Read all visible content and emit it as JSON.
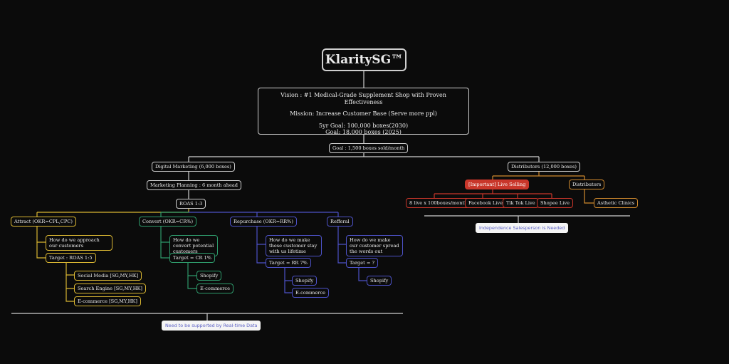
{
  "title": "KlaritySG™",
  "vision": {
    "vision": "Vision : #1 Medical-Grade Supplement Shop with Proven Effectiveness",
    "mission": "Mission: Increase Customer Base (Serve more ppl)",
    "goal_5yr": "5yr Goal: 100,000 boxes(2030)",
    "goal_2025": "Goal: 18,000 boxes (2025)"
  },
  "monthly_goal": "Goal : 1,500 boxes sold/month",
  "digital": {
    "label": "Digital Marketing (6,000 boxes)",
    "planning": "Marketing Planning : 6 month ahead",
    "roas": "ROAS 1:3",
    "attract": {
      "label": "Attract (OKR=CPL,CPC)",
      "question": "How do we approach our customers",
      "target": "Target : ROAS 1:5",
      "channels": [
        "Social Media [SG,MY,HK]",
        "Search Engine [SG,MY,HK]",
        "E-commerce [SG,MY,HK]"
      ]
    },
    "convert": {
      "label": "Convert (OKR=CR%)",
      "question": "How do we convert potential customers",
      "target": "Target = CR 1%",
      "channels": [
        "Shopify",
        "E-commerce"
      ]
    },
    "repurchase": {
      "label": "Repurchase (OKR=RR%)",
      "question": "How do we make these customer stay with us lifetime",
      "target": "Target = RR 7%",
      "channels": [
        "Shopify",
        "E-commerce"
      ]
    },
    "referral": {
      "label": "Refferal",
      "question": "How do we make our customer spread the words out",
      "target": "Target = ?",
      "channels": [
        "Shopify"
      ]
    },
    "note": "Need to be supported by Real-time Data"
  },
  "distributors": {
    "label": "Distributors (12,000 boxes)",
    "live_selling": "[Important] Live Selling",
    "live_channels": [
      "8 live x 100boxes/month",
      "Facebook Live",
      "Tik Tok Live",
      "Shopee Live"
    ],
    "distributors_sub": "Distributors",
    "clinics": "Asthetic Clinics",
    "note": "Independence Salesperson is Needed"
  },
  "colors": {
    "background": "#0b0b0b",
    "neutral": "#cfcfcf",
    "attract": "#d9b632",
    "convert": "#2e9a6b",
    "repurchase": "#4d52c7",
    "distributor": "#d08a2e",
    "live": "#c9362a"
  }
}
